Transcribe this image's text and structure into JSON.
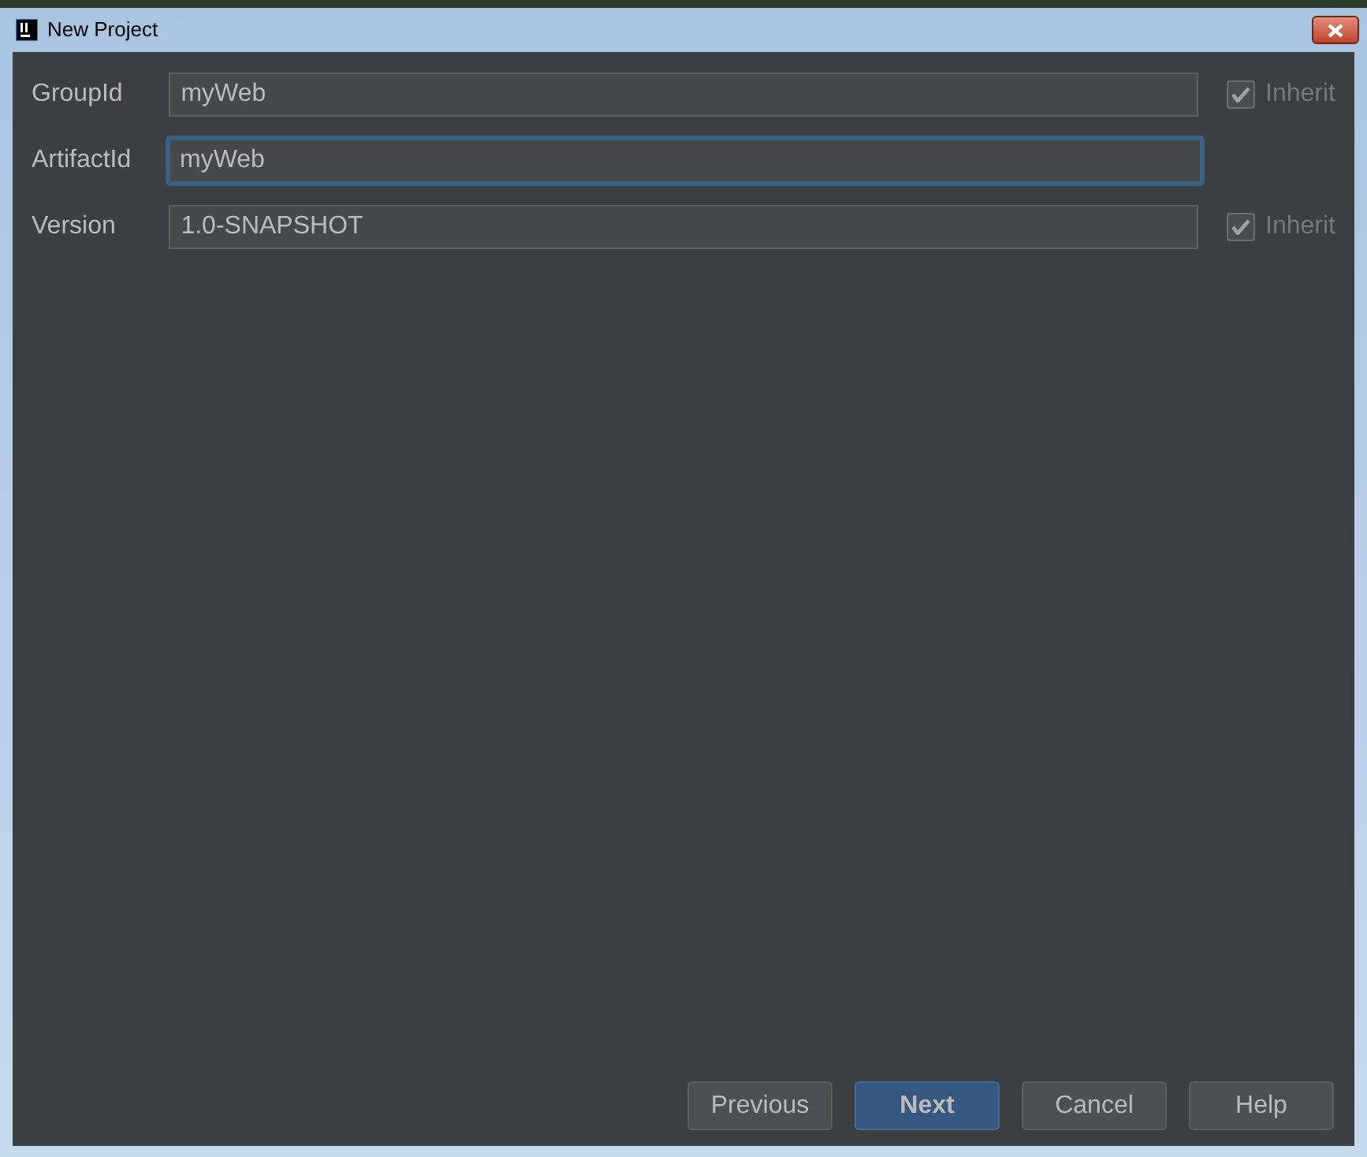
{
  "window": {
    "title": "New Project"
  },
  "fields": [
    {
      "label": "GroupId",
      "value": "myWeb",
      "focused": false,
      "inherit": {
        "label": "Inherit",
        "checked": true
      }
    },
    {
      "label": "ArtifactId",
      "value": "myWeb",
      "focused": true
    },
    {
      "label": "Version",
      "value": "1.0-SNAPSHOT",
      "focused": false,
      "inherit": {
        "label": "Inherit",
        "checked": true
      }
    }
  ],
  "buttons": [
    {
      "label": "Previous",
      "default": false
    },
    {
      "label": "Next",
      "default": true
    },
    {
      "label": "Cancel",
      "default": false
    },
    {
      "label": "Help",
      "default": false
    }
  ]
}
